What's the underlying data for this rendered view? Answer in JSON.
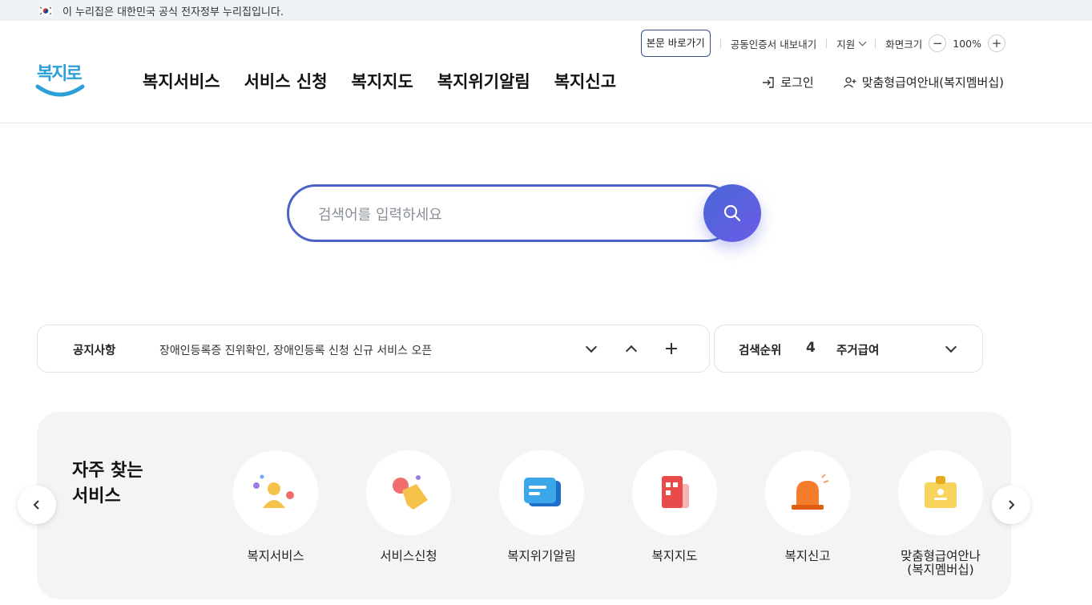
{
  "gov_banner": {
    "text": "이 누리집은 대한민국 공식 전자정부 누리집입니다."
  },
  "utility": {
    "skip_label": "본문 바로가기",
    "cert_label": "공동인증서 내보내기",
    "support_label": "지원",
    "zoom_label": "화면크기",
    "zoom_value": "100%",
    "zoom_minus": "−",
    "zoom_plus": "+"
  },
  "logo": {
    "text": "복지로"
  },
  "gnb": [
    {
      "label": "복지서비스"
    },
    {
      "label": "서비스 신청"
    },
    {
      "label": "복지지도"
    },
    {
      "label": "복지위기알림"
    },
    {
      "label": "복지신고"
    }
  ],
  "user_links": {
    "login": "로그인",
    "membership": "맞춤형급여안내(복지멤버십)"
  },
  "search": {
    "placeholder": "검색어를 입력하세요"
  },
  "notice": {
    "label": "공지사항",
    "text": "장애인등록증 진위확인, 장애인등록 신청 신규 서비스 오픈"
  },
  "search_rank": {
    "label": "검색순위",
    "rank": "4",
    "term": "주거급여"
  },
  "frequent": {
    "title_line1": "자주 찾는",
    "title_line2": "서비스",
    "items": [
      {
        "label": "복지서비스",
        "icon": "person-icon"
      },
      {
        "label": "서비스신청",
        "icon": "hand-tap-icon"
      },
      {
        "label": "복지위기알림",
        "icon": "message-icon"
      },
      {
        "label": "복지지도",
        "icon": "map-building-icon"
      },
      {
        "label": "복지신고",
        "icon": "siren-icon"
      },
      {
        "label": "맞춤형급여안나\n(복지멤버십)",
        "label_line1": "맞춤형급여안나",
        "label_line2": "(복지멤버십)",
        "icon": "id-card-icon"
      }
    ]
  },
  "colors": {
    "accent": "#4b63c8",
    "logo": "#2c9fd9",
    "panel_bg": "#f3f4f6"
  }
}
